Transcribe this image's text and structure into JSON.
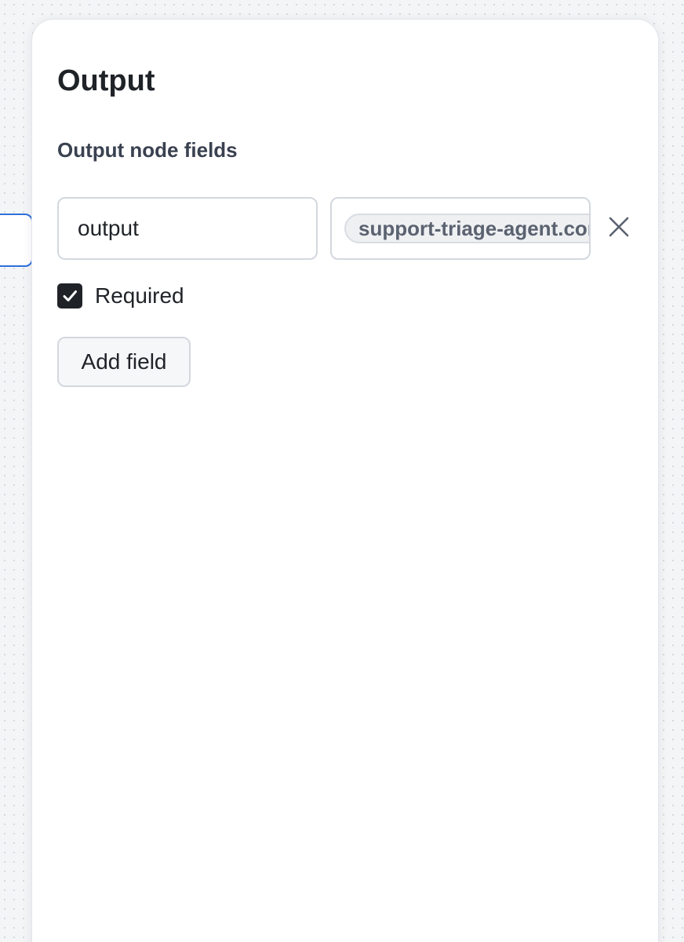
{
  "panel": {
    "title": "Output",
    "section_label": "Output node fields",
    "fields": [
      {
        "name_value": "output",
        "type_value": "support-triage-agent.cor",
        "required_label": "Required",
        "required_checked": true
      }
    ],
    "add_field_label": "Add field"
  },
  "icons": {
    "remove": "close-icon",
    "checkbox": "checkmark-icon"
  },
  "colors": {
    "accent": "#2f6fdb",
    "checkbox": "#1f2328",
    "chip_background": "#eef0f2"
  }
}
